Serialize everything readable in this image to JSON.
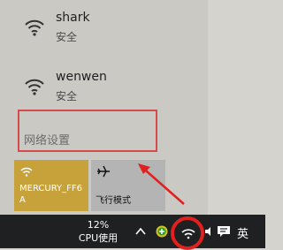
{
  "networks": [
    {
      "ssid": "shark",
      "status": "安全"
    },
    {
      "ssid": "wenwen",
      "status": "安全"
    }
  ],
  "network_settings_label": "网络设置",
  "quick_actions": {
    "wifi_label": "MERCURY_FF6A",
    "airplane_label": "飞行模式"
  },
  "taskbar": {
    "cpu_percent": "12%",
    "cpu_label": "CPU使用",
    "language": "英"
  },
  "colors": {
    "wifi_tile": "#c7a13a",
    "highlight": "#d74b4b",
    "taskbar": "#1e2022"
  },
  "icons": [
    "wifi-icon",
    "airplane-icon",
    "chevron-up-icon",
    "speaker-icon",
    "message-icon"
  ]
}
